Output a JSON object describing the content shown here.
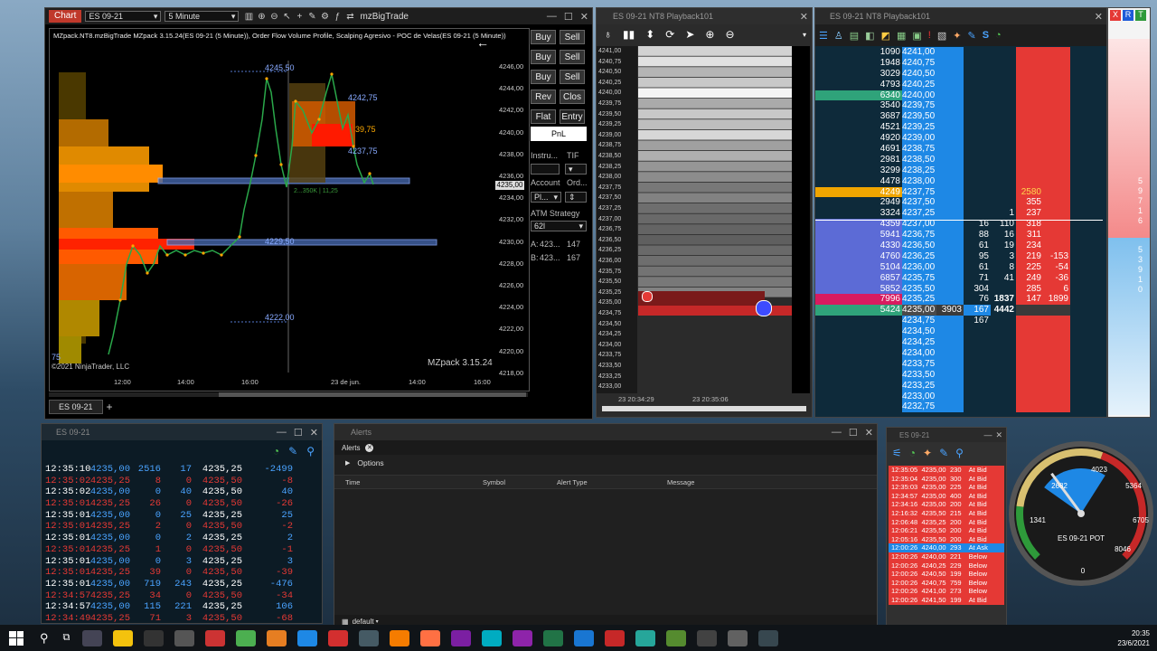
{
  "chart": {
    "tag": "Chart",
    "instrument": "ES 09-21",
    "interval": "5 Minute",
    "strategy": "mzBigTrade",
    "header": "MZpack.NT8.mzBigTrade MZpack 3.15.24(ES 09-21 (5 Minute)), Order Flow Volume Profile, Scalping Agresivo - POC de Velas(ES 09-21 (5 Minute))",
    "watermark": "MZpack 3.15.24",
    "copyright": "©2021 NinjaTrader, LLC",
    "tab": "ES 09-21",
    "tab_add": "+",
    "price_axis": [
      "4246,00",
      "4244,00",
      "4242,00",
      "4240,00",
      "4238,00",
      "4236,00",
      "4234,00",
      "4232,00",
      "4230,00",
      "4228,00",
      "4226,00",
      "4224,00",
      "4222,00",
      "4220,00",
      "4218,00"
    ],
    "current_price": "4235,00",
    "time_axis": [
      "12:00",
      "14:00",
      "16:00",
      "23 de jun.",
      "14:00",
      "16:00"
    ],
    "level_labels": {
      "top": "4245,50",
      "mid": "4242,75",
      "poc": "4229,50",
      "low": "4222,00",
      "r1": "39,75",
      "r2": "4237,75"
    },
    "bottom_left_label": "75",
    "cursor_label": "2...350K | 11,25",
    "level_fill": 0.58
  },
  "order_panel": {
    "buttons": [
      [
        "Buy",
        "Sell"
      ],
      [
        "Buy",
        "Sell"
      ],
      [
        "Buy",
        "Sell"
      ],
      [
        "Rev",
        "Clos"
      ]
    ],
    "flat": "Flat",
    "entry": "Entry",
    "pnl": "PnL",
    "instrument_label": "Instru...",
    "tif_label": "TIF",
    "account_label": "Account",
    "order_label": "Ord...",
    "account_value": "Pl...",
    "atm_label": "ATM Strategy",
    "atm_value": "62l",
    "ask": "A:",
    "ask_price": "423...",
    "ask_qty": "147",
    "bid": "B:",
    "bid_price": "423...",
    "bid_qty": "167"
  },
  "heatmap": {
    "title": "ES 09-21 NT8 Playback101",
    "prices": [
      "4241,00",
      "4240,75",
      "4240,50",
      "4240,25",
      "4240,00",
      "4239,75",
      "4239,50",
      "4239,25",
      "4239,00",
      "4238,75",
      "4238,50",
      "4238,25",
      "4238,00",
      "4237,75",
      "4237,50",
      "4237,25",
      "4237,00",
      "4236,75",
      "4236,50",
      "4236,25",
      "4236,00",
      "4235,75",
      "4235,50",
      "4235,25",
      "4235,00",
      "4234,75",
      "4234,50",
      "4234,25",
      "4234,00",
      "4233,75",
      "4233,50",
      "4233,25",
      "4233,00"
    ],
    "times": [
      "23 20:34:29",
      "23 20:35:06"
    ]
  },
  "dom": {
    "title": "ES 09-21 NT8 Playback101",
    "rows": [
      [
        "1090",
        "4241,00",
        "",
        "",
        "",
        "",
        ""
      ],
      [
        "1948",
        "4240,75",
        "",
        "",
        "",
        "",
        ""
      ],
      [
        "3029",
        "4240,50",
        "",
        "",
        "",
        "",
        ""
      ],
      [
        "4793",
        "4240,25",
        "",
        "",
        "",
        "",
        ""
      ],
      [
        "6340",
        "4240,00",
        "",
        "",
        "",
        "",
        ""
      ],
      [
        "3540",
        "4239,75",
        "",
        "",
        "",
        "",
        ""
      ],
      [
        "3687",
        "4239,50",
        "",
        "",
        "",
        "",
        ""
      ],
      [
        "4521",
        "4239,25",
        "",
        "",
        "",
        "",
        ""
      ],
      [
        "4920",
        "4239,00",
        "",
        "",
        "",
        "",
        ""
      ],
      [
        "4691",
        "4238,75",
        "",
        "",
        "",
        "",
        ""
      ],
      [
        "2981",
        "4238,50",
        "",
        "",
        "",
        "",
        ""
      ],
      [
        "3299",
        "4238,25",
        "",
        "",
        "",
        "",
        ""
      ],
      [
        "4478",
        "4238,00",
        "",
        "",
        "",
        "",
        ""
      ],
      [
        "4249",
        "4237,75",
        "",
        "",
        "",
        "2580",
        ""
      ],
      [
        "2949",
        "4237,50",
        "",
        "",
        "",
        "355",
        ""
      ],
      [
        "3324",
        "4237,25",
        "",
        "",
        "1",
        "237",
        ""
      ],
      [
        "4359",
        "4237,00",
        "",
        "16",
        "110",
        "318",
        ""
      ],
      [
        "5941",
        "4236,75",
        "",
        "88",
        "16",
        "311",
        ""
      ],
      [
        "4330",
        "4236,50",
        "",
        "61",
        "19",
        "234",
        ""
      ],
      [
        "4760",
        "4236,25",
        "",
        "95",
        "3",
        "219",
        "-153"
      ],
      [
        "5104",
        "4236,00",
        "",
        "61",
        "8",
        "225",
        "-54"
      ],
      [
        "6857",
        "4235,75",
        "",
        "71",
        "41",
        "249",
        "-36"
      ],
      [
        "5852",
        "4235,50",
        "",
        "304",
        "",
        "285",
        "6"
      ],
      [
        "7996",
        "4235,25",
        "",
        "76",
        "1837",
        "147",
        "1899"
      ],
      [
        "5424",
        "4235,00",
        "3903",
        "167",
        "4442",
        "",
        ""
      ],
      [
        "",
        "4234,75",
        "",
        "167",
        "",
        "",
        ""
      ],
      [
        "",
        "4234,50",
        "",
        "",
        "",
        "",
        ""
      ],
      [
        "",
        "4234,25",
        "",
        "",
        "",
        "",
        ""
      ],
      [
        "",
        "4234,00",
        "",
        "",
        "",
        "",
        ""
      ],
      [
        "",
        "4233,75",
        "",
        "",
        "",
        "",
        ""
      ],
      [
        "",
        "4233,50",
        "",
        "",
        "",
        "",
        ""
      ],
      [
        "",
        "4233,25",
        "",
        "",
        "",
        "",
        ""
      ],
      [
        "",
        "4233,00",
        "",
        "",
        "",
        "",
        ""
      ],
      [
        "",
        "4232,75",
        "",
        "",
        "",
        "",
        ""
      ]
    ],
    "side_top": [
      "5",
      "9",
      "7",
      "1",
      "6"
    ],
    "side_bottom": [
      "5",
      "3",
      "9",
      "1",
      "0"
    ]
  },
  "timesales": {
    "title": "ES 09-21",
    "rows": [
      [
        "12:35:10",
        "4235,00",
        "2516",
        "17",
        "4235,25",
        "-2499",
        "blue"
      ],
      [
        "12:35:02",
        "4235,25",
        "8",
        "0",
        "4235,50",
        "-8",
        "red"
      ],
      [
        "12:35:02",
        "4235,00",
        "0",
        "40",
        "4235,50",
        "40",
        "blue"
      ],
      [
        "12:35:01",
        "4235,25",
        "26",
        "0",
        "4235,50",
        "-26",
        "red"
      ],
      [
        "12:35:01",
        "4235,00",
        "0",
        "25",
        "4235,25",
        "25",
        "blue"
      ],
      [
        "12:35:01",
        "4235,25",
        "2",
        "0",
        "4235,50",
        "-2",
        "red"
      ],
      [
        "12:35:01",
        "4235,00",
        "0",
        "2",
        "4235,25",
        "2",
        "blue"
      ],
      [
        "12:35:01",
        "4235,25",
        "1",
        "0",
        "4235,50",
        "-1",
        "red"
      ],
      [
        "12:35:01",
        "4235,00",
        "0",
        "3",
        "4235,25",
        "3",
        "blue"
      ],
      [
        "12:35:01",
        "4235,25",
        "39",
        "0",
        "4235,50",
        "-39",
        "red"
      ],
      [
        "12:35:01",
        "4235,00",
        "719",
        "243",
        "4235,25",
        "-476",
        "blue"
      ],
      [
        "12:34:57",
        "4235,25",
        "34",
        "0",
        "4235,50",
        "-34",
        "red"
      ],
      [
        "12:34:57",
        "4235,00",
        "115",
        "221",
        "4235,25",
        "106",
        "blue"
      ],
      [
        "12:34:49",
        "4235,25",
        "71",
        "3",
        "4235,50",
        "-68",
        "red"
      ]
    ]
  },
  "alerts": {
    "title": "Alerts",
    "tab": "Alerts",
    "options": "Options",
    "columns": [
      "Time",
      "Symbol",
      "Alert Type",
      "Message"
    ],
    "footer": "default"
  },
  "tns": {
    "title": "ES 09-21",
    "rows": [
      [
        "12:35:05",
        "4235,00",
        "230",
        "At Bid",
        "red"
      ],
      [
        "12:35:04",
        "4235,00",
        "300",
        "At Bid",
        "red"
      ],
      [
        "12:35:03",
        "4235,00",
        "225",
        "At Bid",
        "red"
      ],
      [
        "12:34:57",
        "4235,00",
        "400",
        "At Bid",
        "red"
      ],
      [
        "12:34:16",
        "4235,00",
        "200",
        "At Bid",
        "red"
      ],
      [
        "12:16:32",
        "4235,50",
        "215",
        "At Bid",
        "red"
      ],
      [
        "12:06:48",
        "4235,25",
        "200",
        "At Bid",
        "red"
      ],
      [
        "12:06:21",
        "4235,50",
        "200",
        "At Bid",
        "red"
      ],
      [
        "12:05:16",
        "4235,50",
        "200",
        "At Bid",
        "red"
      ],
      [
        "12:00:26",
        "4240,00",
        "293",
        "At Ask",
        "blue"
      ],
      [
        "12:00:26",
        "4240,00",
        "221",
        "Below",
        "red"
      ],
      [
        "12:00:26",
        "4240,25",
        "229",
        "Below",
        "red"
      ],
      [
        "12:00:26",
        "4240,50",
        "199",
        "Below",
        "red"
      ],
      [
        "12:00:26",
        "4240,75",
        "759",
        "Below",
        "red"
      ],
      [
        "12:00:26",
        "4241,00",
        "273",
        "Below",
        "red"
      ],
      [
        "12:00:26",
        "4241,50",
        "199",
        "At Bid",
        "red"
      ]
    ]
  },
  "gauge": {
    "ticks": [
      "1341",
      "2682",
      "4023",
      "5364",
      "6705",
      "8046",
      "0"
    ],
    "label": "ES 09-21 POT",
    "fill": 0.62
  },
  "taskbar": {
    "time": "20:35",
    "date": "23/6/2021"
  },
  "colors": {
    "bid": "#e03a3a",
    "ask": "#1e88e5",
    "dom_blue": "#2a8ad4",
    "dom_red": "#e53935"
  }
}
